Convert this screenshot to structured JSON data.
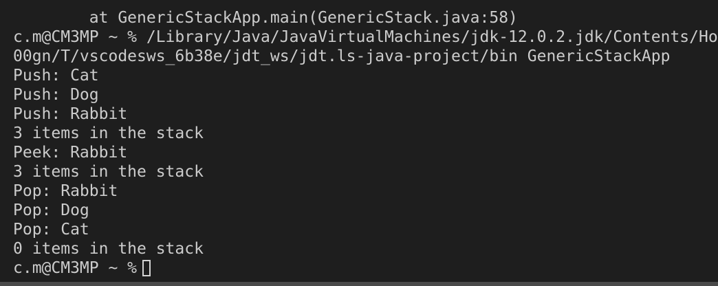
{
  "terminal": {
    "lines": [
      "        at GenericStackApp.main(GenericStack.java:58)",
      "c.m@CM3MP ~ % /Library/Java/JavaVirtualMachines/jdk-12.0.2.jdk/Contents/Ho",
      "00gn/T/vscodesws_6b38e/jdt_ws/jdt.ls-java-project/bin GenericStackApp",
      "Push: Cat",
      "Push: Dog",
      "Push: Rabbit",
      "3 items in the stack",
      "Peek: Rabbit",
      "3 items in the stack",
      "Pop: Rabbit",
      "Pop: Dog",
      "Pop: Cat",
      "0 items in the stack"
    ],
    "prompt": "c.m@CM3MP ~ %"
  },
  "colors": {
    "background": "#1e1e1e",
    "text": "#cccccc",
    "cursor": "#d4d4d4"
  }
}
